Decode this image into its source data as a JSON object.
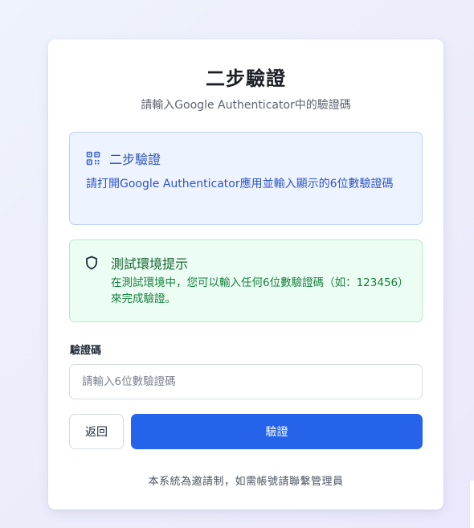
{
  "card": {
    "title": "二步驗證",
    "subtitle": "請輸入Google Authenticator中的驗證碼"
  },
  "info_box": {
    "icon": "qr-code-icon",
    "title": "二步驗證",
    "text": "請打開Google Authenticator應用並輸入顯示的6位數驗證碼"
  },
  "test_notice": {
    "icon": "shield-icon",
    "title": "測試環境提示",
    "text": "在測試環境中，您可以輸入任何6位數驗證碼（如：123456）來完成驗證。"
  },
  "form": {
    "code_label": "驗證碼",
    "code_value": "",
    "code_placeholder": "請輸入6位數驗證碼",
    "back_label": "返回",
    "verify_label": "驗證"
  },
  "footer": {
    "note": "本系統為邀請制，如需帳號請聯繫管理員"
  },
  "colors": {
    "primary": "#2563eb",
    "info_bg": "#eef4ff",
    "info_text": "#2e54c7",
    "success_bg": "#ecfdf3",
    "success_text": "#15803d"
  }
}
